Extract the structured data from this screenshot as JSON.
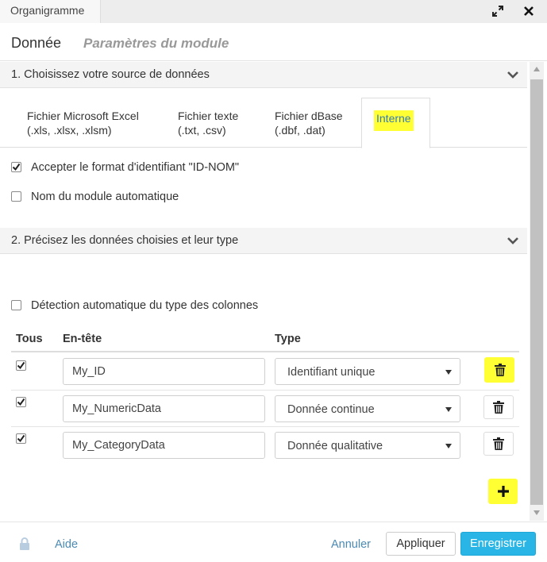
{
  "window": {
    "title": "Organigramme"
  },
  "main_tabs": [
    {
      "label": "Donnée",
      "active": true
    },
    {
      "label": "Paramètres du module",
      "active": false
    }
  ],
  "section1": {
    "title": "1. Choisissez votre source de données"
  },
  "source_tabs": [
    {
      "line1": "Fichier Microsoft Excel",
      "line2": "(.xls, .xlsx, .xlsm)"
    },
    {
      "line1": "Fichier texte",
      "line2": "(.txt, .csv)"
    },
    {
      "line1": "Fichier dBase",
      "line2": "(.dbf, .dat)"
    },
    {
      "line1": "Interne",
      "active": true
    }
  ],
  "options": {
    "accept_id_format": {
      "label": "Accepter le format d'identifiant \"ID-NOM\"",
      "checked": true
    },
    "auto_module_name": {
      "label": "Nom du module automatique",
      "checked": false
    }
  },
  "section2": {
    "title": "2. Précisez les données choisies et leur type"
  },
  "auto_detect": {
    "label": "Détection automatique du type des colonnes",
    "checked": false
  },
  "table": {
    "headers": {
      "all": "Tous",
      "header": "En-tête",
      "type": "Type"
    },
    "rows": [
      {
        "checked": true,
        "name": "My_ID",
        "type": "Identifiant unique"
      },
      {
        "checked": true,
        "name": "My_NumericData",
        "type": "Donnée continue"
      },
      {
        "checked": true,
        "name": "My_CategoryData",
        "type": "Donnée qualitative"
      }
    ]
  },
  "footer": {
    "help": "Aide",
    "cancel": "Annuler",
    "apply": "Appliquer",
    "save": "Enregistrer"
  },
  "colors": {
    "accent": "#29b6e6",
    "highlight": "#ffff33",
    "link": "#4a8ab5"
  }
}
